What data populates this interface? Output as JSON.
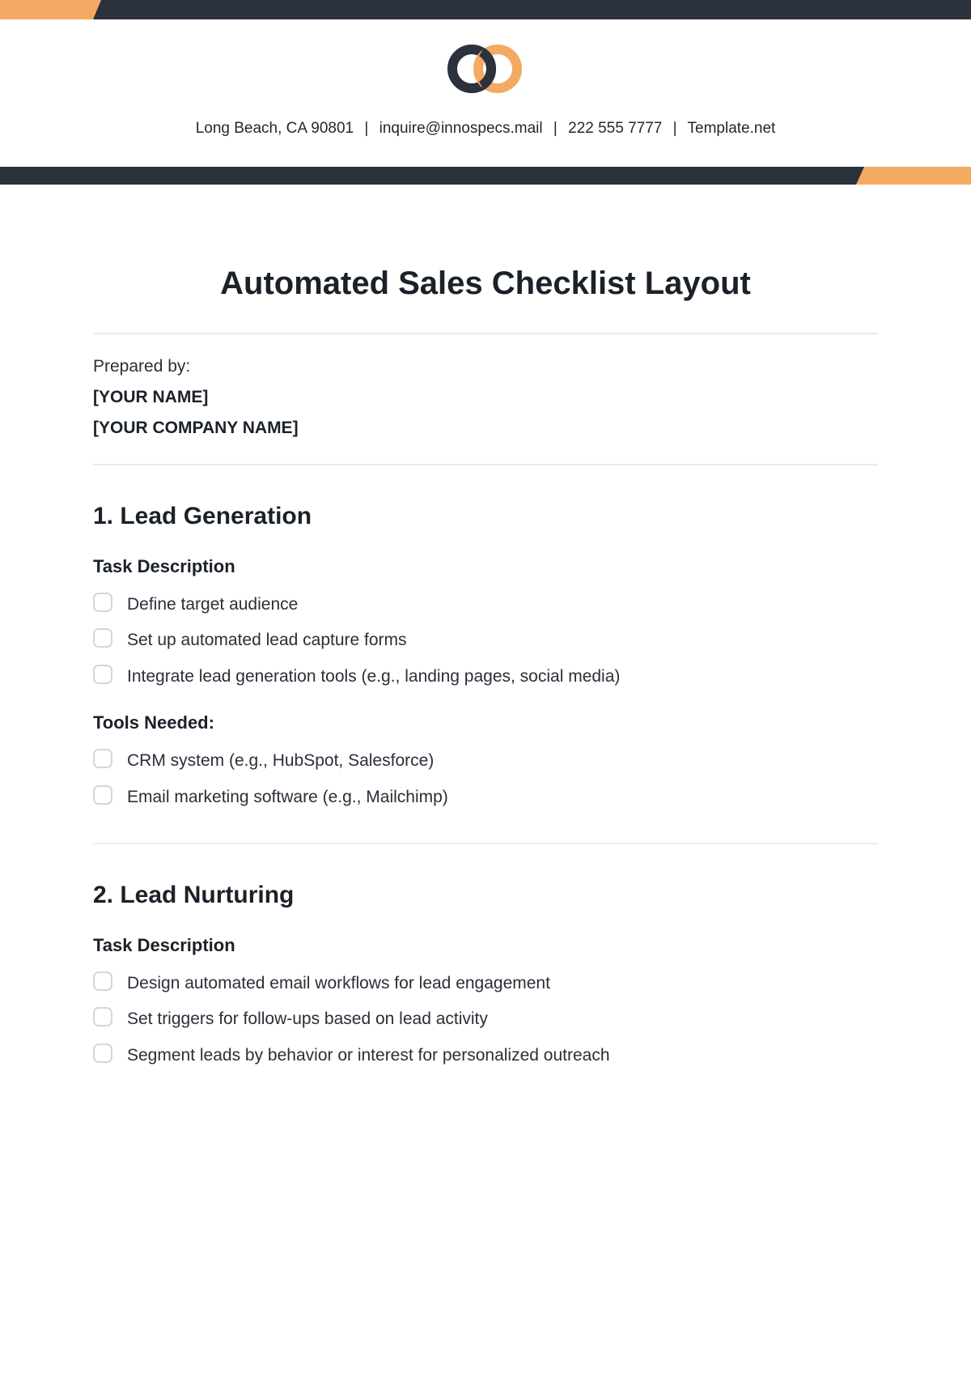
{
  "header": {
    "contact": {
      "address": "Long Beach, CA 90801",
      "email": "inquire@innospecs.mail",
      "phone": "222 555 7777",
      "site": "Template.net"
    }
  },
  "title": "Automated Sales Checklist Layout",
  "prepared": {
    "label": "Prepared by:",
    "name": "[YOUR NAME]",
    "company": "[YOUR COMPANY NAME]"
  },
  "sections": [
    {
      "heading": "1. Lead Generation",
      "groups": [
        {
          "label": "Task Description",
          "items": [
            "Define target audience",
            "Set up automated lead capture forms",
            "Integrate lead generation tools (e.g., landing pages, social media)"
          ]
        },
        {
          "label": "Tools Needed:",
          "items": [
            "CRM system (e.g., HubSpot, Salesforce)",
            "Email marketing software (e.g., Mailchimp)"
          ]
        }
      ]
    },
    {
      "heading": "2. Lead Nurturing",
      "groups": [
        {
          "label": "Task Description",
          "items": [
            "Design automated email workflows for lead engagement",
            "Set triggers for follow-ups based on lead activity",
            "Segment leads by behavior or interest for personalized outreach"
          ]
        }
      ]
    }
  ],
  "colors": {
    "accent": "#f4aa63",
    "dark": "#2b323b"
  }
}
